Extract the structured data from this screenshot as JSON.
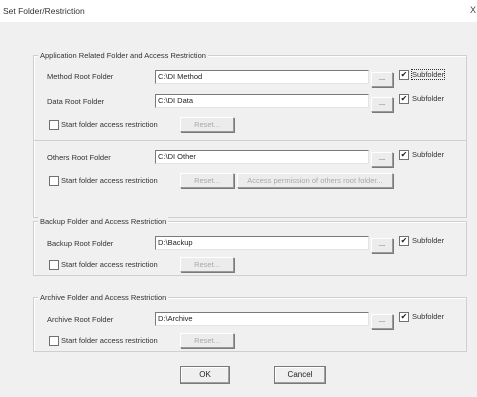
{
  "window": {
    "title": "Set Folder/Restriction",
    "close_label": "X"
  },
  "app_group": {
    "title": "Application Related Folder and Access Restriction",
    "method": {
      "label": "Method Root Folder",
      "value": "C:\\DI Method",
      "browse": "...",
      "subfolder_label": "Subfolder",
      "subfolder_checked": true
    },
    "data": {
      "label": "Data Root Folder",
      "value": "C:\\DI  Data",
      "browse": "...",
      "subfolder_label": "Subfolder",
      "subfolder_checked": true
    },
    "restrict_label": "Start folder access restriction",
    "reset_label": "Reset...",
    "others": {
      "label": "Others Root Folder",
      "value": "C:\\DI Other",
      "browse": "...",
      "subfolder_label": "Subfolder",
      "subfolder_checked": true
    },
    "others_restrict_label": "Start folder access restriction",
    "others_reset_label": "Reset...",
    "access_permission_label": "Access permission of others root folder..."
  },
  "backup_group": {
    "title": "Backup Folder and Access Restriction",
    "label": "Backup Root Folder",
    "value": "D:\\Backup",
    "browse": "...",
    "subfolder_label": "Subfolder",
    "subfolder_checked": true,
    "restrict_label": "Start folder access restriction",
    "reset_label": "Reset..."
  },
  "archive_group": {
    "title": "Archive Folder and Access Restriction",
    "label": "Archive Root Folder",
    "value": "D:\\Archive",
    "browse": "...",
    "subfolder_label": "Subfolder",
    "subfolder_checked": true,
    "restrict_label": "Start folder access restriction",
    "reset_label": "Reset..."
  },
  "footer": {
    "ok_label": "OK",
    "cancel_label": "Cancel"
  },
  "glyphs": {
    "check": "✔"
  }
}
